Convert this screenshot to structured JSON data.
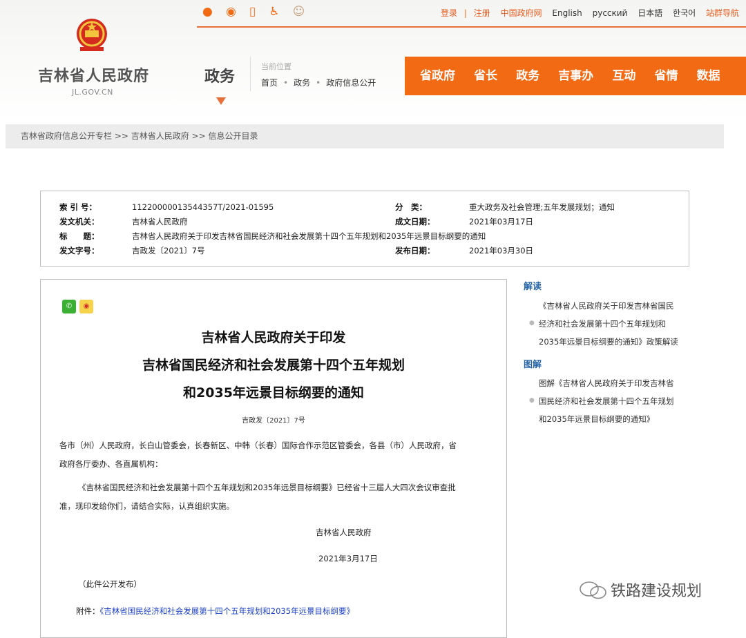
{
  "top_links": {
    "login": "登录",
    "register": "注册",
    "gov_cn": "中国政府网",
    "english": "English",
    "russian": "русский",
    "japanese": "日本語",
    "korean": "한국어",
    "site_nav": "站群导航"
  },
  "site": {
    "title": "吉林省人民政府",
    "domain": "JL.GOV.CN",
    "section": "政务"
  },
  "location": {
    "label": "当前位置",
    "items": [
      "首页",
      "政务",
      "政府信息公开"
    ]
  },
  "main_nav": [
    "省政府",
    "省长",
    "政务",
    "吉事办",
    "互动",
    "省情",
    "数据"
  ],
  "breadcrumb": "吉林省政府信息公开专栏 >> 吉林省人民政府 >> 信息公开目录",
  "meta": {
    "index_label": "索 引 号：",
    "index_value": "11220000013544357T/2021-01595",
    "category_label": "分　类：",
    "category_value": "重大政务及社会管理;五年发展规划；通知",
    "issuer_label": "发文机关：",
    "issuer_value": "吉林省人民政府",
    "date_label": "成文日期：",
    "date_value": "2021年03月17日",
    "title_label": "标　　题：",
    "title_value": "吉林省人民政府关于印发吉林省国民经济和社会发展第十四个五年规划和2035年远景目标纲要的通知",
    "docno_label": "发文字号：",
    "docno_value": "吉政发〔2021〕7号",
    "publish_label": "发布日期：",
    "publish_value": "2021年03月30日"
  },
  "document": {
    "title_line1": "吉林省人民政府关于印发",
    "title_line2": "吉林省国民经济和社会发展第十四个五年规划",
    "title_line3": "和2035年远景目标纲要的通知",
    "doc_number": "吉政发〔2021〕7号",
    "recipients_l1": "各市（州）人民政府，长白山管委会，长春新区、中韩（长春）国际合作示范区管委会，各县（市）人民政府，省",
    "recipients_l2": "政府各厅委办、各直属机构：",
    "body_l1": "《吉林省国民经济和社会发展第十四个五年规划和2035年远景目标纲要》已经省十三届人大四次会议审查批",
    "body_l2": "准，现印发给你们，请结合实际，认真组织实施。",
    "signer": "吉林省人民政府",
    "sign_date": "2021年3月17日",
    "note": "（此件公开发布）",
    "attachment_label": "附件：",
    "attachment_link": "《吉林省国民经济和社会发展第十四个五年规划和2035年远景目标纲要》"
  },
  "sidebar": {
    "interpret_heading": "解读",
    "interpret_l1": "《吉林省人民政府关于印发吉林省国民",
    "interpret_l2": "经济和社会发展第十四个五年规划和",
    "interpret_l3": "2035年远景目标纲要的通知》政策解读",
    "graphic_heading": "图解",
    "graphic_l1": "图解《吉林省人民政府关于印发吉林省",
    "graphic_l2": "国民经济和社会发展第十四个五年规划",
    "graphic_l3": "和2035年远景目标纲要的通知》"
  },
  "watermark": "铁路建设规划",
  "colors": {
    "accent": "#f26a14",
    "link": "#1a3fc7",
    "sidebar_heading": "#2767a8"
  }
}
